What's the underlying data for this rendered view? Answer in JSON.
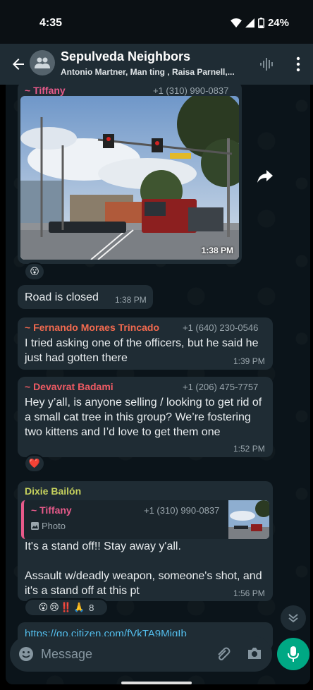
{
  "status_bar": {
    "time": "4:35",
    "battery": "24%"
  },
  "header": {
    "title": "Sepulveda Neighbors",
    "members": "Antonio Martner, Man ting , Raisa Parnell,..."
  },
  "messages": [
    {
      "sender": "~ Tiffany",
      "sender_color": "#e75a8a",
      "phone": "+1 (310) 990-0837",
      "time": "1:38 PM",
      "reactions": [
        "😮"
      ]
    },
    {
      "text": "Road is closed",
      "time": "1:38 PM"
    },
    {
      "sender": "~ Fernando Moraes Trincado",
      "sender_color": "#f36a4f",
      "phone": "+1 (640) 230-0546",
      "text": "I tried asking one of the officers, but he said he just had gotten there",
      "time": "1:39 PM"
    },
    {
      "sender": "~ Devavrat Badami",
      "sender_color": "#f05b64",
      "phone": "+1 (206) 475-7757",
      "text": "Hey y’all, is anyone selling / looking to get rid of a small cat tree in this group? We’re fostering two kittens and I’d love to get them one",
      "time": "1:52 PM",
      "reactions": [
        "❤️"
      ]
    },
    {
      "sender": "Dixie Bailón",
      "sender_color": "#c5d15d",
      "quote": {
        "sender": "~ Tiffany",
        "phone": "+1 (310) 990-0837",
        "label": "Photo"
      },
      "text_line1": "It's a stand off!! Stay away y'all.",
      "text_line2": "Assault w/deadly weapon, someone's shot, and it's a stand off at this pt",
      "time": "1:56 PM",
      "reactions": [
        "😮",
        "😢",
        "‼️",
        "🙏"
      ],
      "reaction_count": "8"
    },
    {
      "link": "https://go.citizen.com/fVkTA9MiqIb"
    }
  ],
  "compose": {
    "placeholder": "Message"
  },
  "colors": {
    "bubble": "#1f2c34",
    "background": "#0b141a",
    "accent": "#00a884",
    "link": "#53bdeb"
  }
}
